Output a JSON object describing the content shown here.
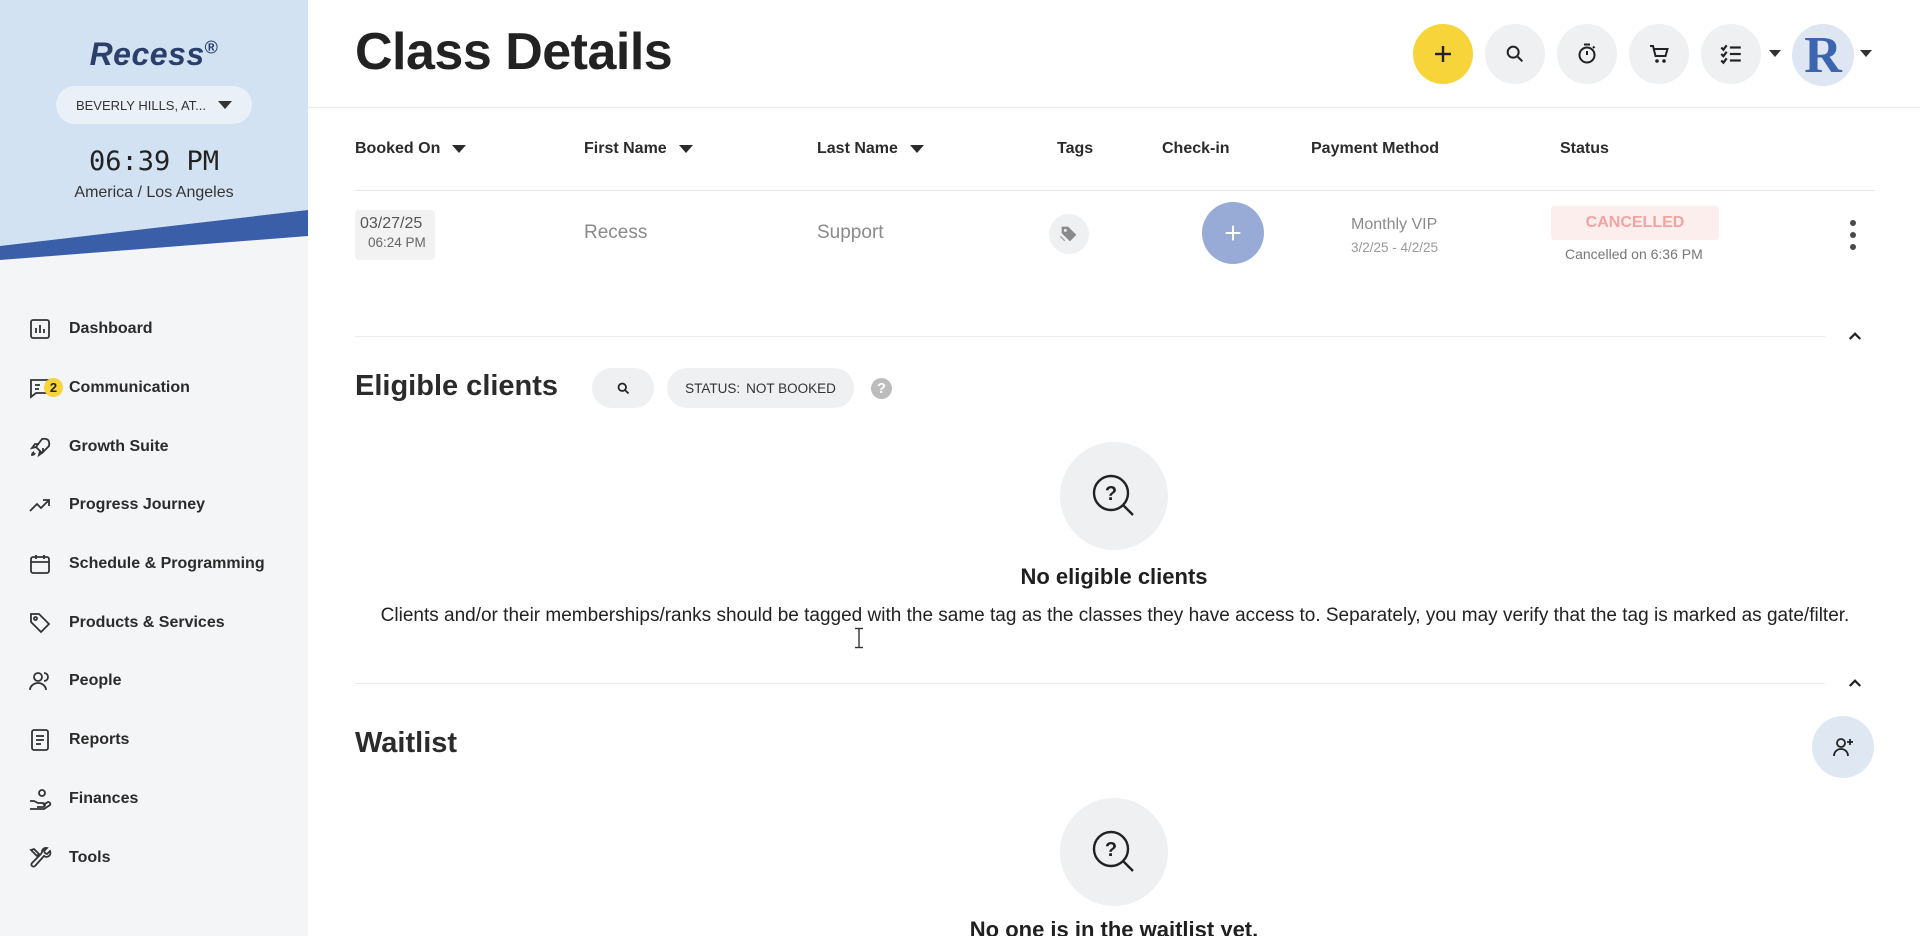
{
  "sidebar": {
    "logo": "Recess",
    "logo_mark": "®",
    "location": "BEVERLY HILLS, AT...",
    "time": "06:39 PM",
    "timezone": "America / Los Angeles",
    "items": [
      {
        "label": "Dashboard",
        "icon": "bar-chart-icon"
      },
      {
        "label": "Communication",
        "icon": "chat-icon",
        "badge": "2"
      },
      {
        "label": "Growth Suite",
        "icon": "rocket-icon"
      },
      {
        "label": "Progress Journey",
        "icon": "trend-icon"
      },
      {
        "label": "Schedule & Programming",
        "icon": "calendar-icon"
      },
      {
        "label": "Products & Services",
        "icon": "tag-icon"
      },
      {
        "label": "People",
        "icon": "people-icon"
      },
      {
        "label": "Reports",
        "icon": "report-icon"
      },
      {
        "label": "Finances",
        "icon": "hand-coins-icon"
      },
      {
        "label": "Tools",
        "icon": "tools-icon"
      }
    ]
  },
  "header": {
    "title": "Class Details",
    "avatar_letter": "R"
  },
  "table": {
    "columns": [
      "Booked On",
      "First Name",
      "Last Name",
      "Tags",
      "Check-in",
      "Payment Method",
      "Status"
    ],
    "rows": [
      {
        "booked_date": "03/27/25",
        "booked_time": "06:24 PM",
        "first_name": "Recess",
        "last_name": "Support",
        "payment_method": "Monthly VIP",
        "payment_period": "3/2/25 - 4/2/25",
        "status": "CANCELLED",
        "status_note": "Cancelled on 6:36 PM"
      }
    ]
  },
  "eligible": {
    "title": "Eligible clients",
    "filter_key": "STATUS:",
    "filter_value": "NOT BOOKED",
    "help": "?",
    "empty_title": "No eligible clients",
    "empty_desc": "Clients and/or their memberships/ranks should be tagged with the same tag as the classes they have access to. Separately, you may verify that the tag is marked as gate/filter."
  },
  "waitlist": {
    "title": "Waitlist",
    "empty_title": "No one is in the waitlist yet."
  },
  "colors": {
    "accent_yellow": "#f7d43a",
    "brand_blue": "#3c65b0",
    "sidebar_header": "#d3e2f3",
    "cancelled_text": "#f2a3a3"
  }
}
